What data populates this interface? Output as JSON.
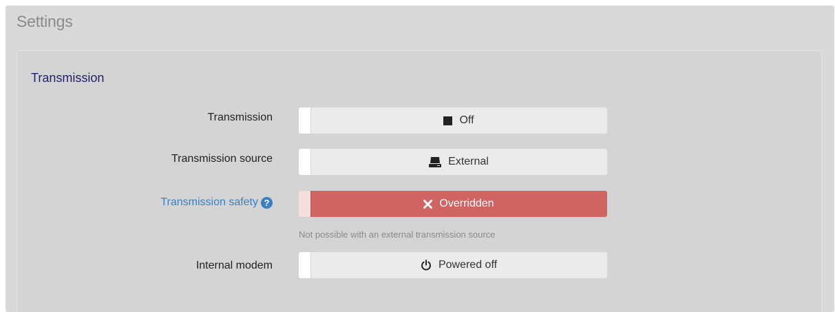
{
  "header": {
    "title": "Settings"
  },
  "section": {
    "title": "Transmission"
  },
  "rows": {
    "transmission": {
      "label": "Transmission",
      "value": "Off",
      "icon": "stop-square-icon"
    },
    "source": {
      "label": "Transmission source",
      "value": "External",
      "icon": "device-external-icon"
    },
    "safety": {
      "label": "Transmission safety",
      "value": "Overridden",
      "icon": "close-x-icon",
      "help_icon": "question-circle-icon",
      "hint": "Not possible with an external transmission source"
    },
    "modem": {
      "label": "Internal modem",
      "value": "Powered off",
      "icon": "power-icon"
    }
  },
  "colors": {
    "danger": "#cf6462",
    "info": "#3b7fc4",
    "section_title": "#1f1f6e"
  }
}
